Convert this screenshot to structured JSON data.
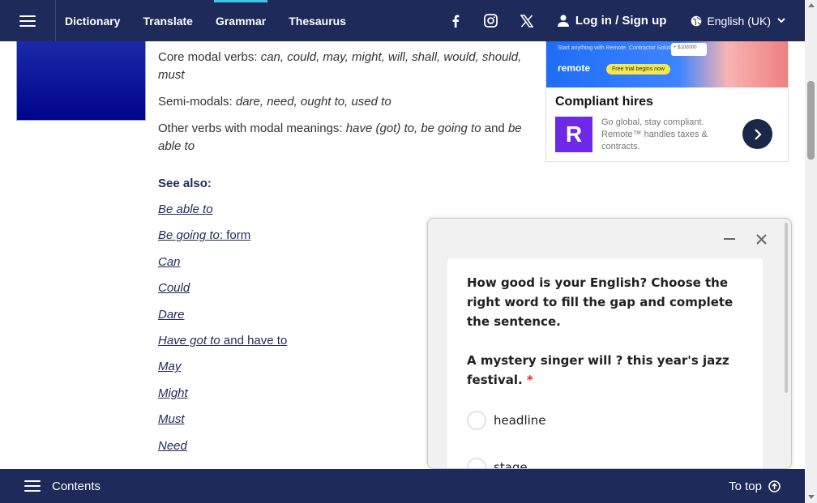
{
  "header": {
    "nav": [
      "Dictionary",
      "Translate",
      "Grammar",
      "Thesaurus"
    ],
    "active_nav": "Grammar",
    "social_icons": [
      "facebook-icon",
      "instagram-icon",
      "x-icon"
    ],
    "login_label": "Log in / Sign up",
    "language_label": "English (UK)",
    "brand_color": "#1d2a5a",
    "accent_color": "#3cc6e8"
  },
  "content": {
    "core_label": "Core modal verbs: ",
    "core_items": "can, could, may, might, will, shall, would, should, must",
    "semi_label": "Semi-modals: ",
    "semi_items": "dare, need, ought to, used to",
    "other_label": "Other verbs with modal meanings: ",
    "other_item1": "have (got) to, be going to",
    "other_and": " and ",
    "other_item2": "be able to",
    "see_also": "See also:",
    "links": [
      {
        "italic": "Be able to",
        "plain": ""
      },
      {
        "italic": "Be going to",
        "plain": ": form"
      },
      {
        "italic": "Can",
        "plain": ""
      },
      {
        "italic": "Could",
        "plain": ""
      },
      {
        "italic": "Dare",
        "plain": ""
      },
      {
        "italic": "Have got to",
        "plain": " and have to"
      },
      {
        "italic": "May",
        "plain": ""
      },
      {
        "italic": "Might",
        "plain": ""
      },
      {
        "italic": "Must",
        "plain": ""
      },
      {
        "italic": "Need",
        "plain": ""
      }
    ]
  },
  "ad": {
    "banner_subtext": "Start anything with Remote. Contractor Solution",
    "banner_brand": "remote",
    "banner_cta": "Free trial begins now",
    "banner_card": "+ $100000",
    "title": "Compliant hires",
    "logo_letter": "R",
    "description": "Go global, stay compliant. Remote™ handles taxes & contracts.",
    "logo_color": "#6f29e6"
  },
  "quiz": {
    "prompt": "How good is your English? Choose the right word to fill the gap and complete the sentence.",
    "sentence": "A mystery singer will ? this year's jazz festival.",
    "required_mark": "*",
    "options": [
      "headline",
      "stage"
    ]
  },
  "footer": {
    "contents_label": "Contents",
    "totop_label": "To top"
  }
}
